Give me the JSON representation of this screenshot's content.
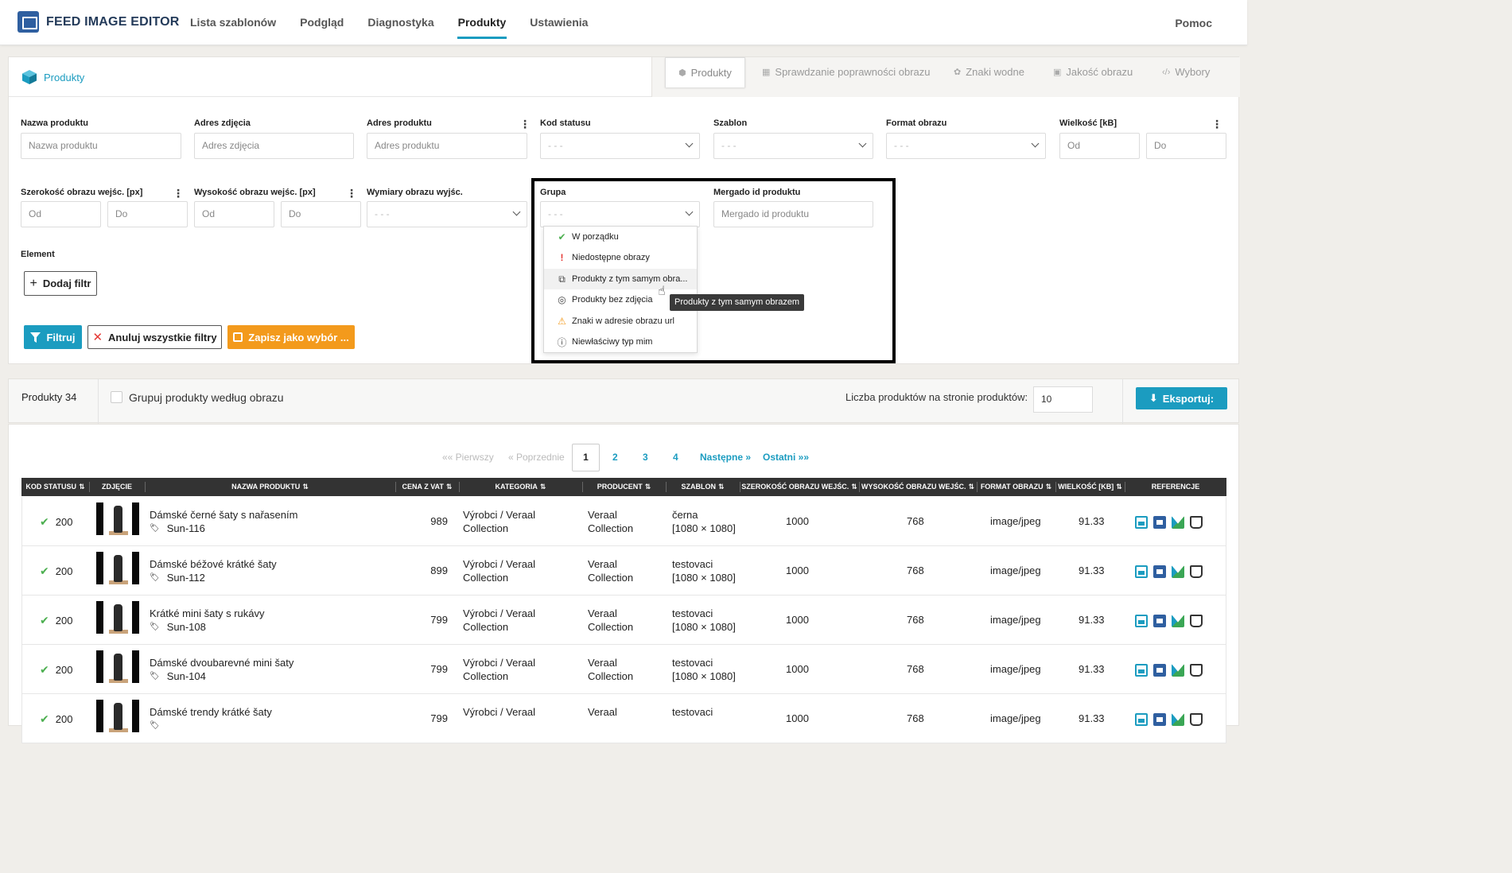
{
  "app": {
    "title": "FEED IMAGE EDITOR",
    "help": "Pomoc"
  },
  "nav": [
    "Lista szablonów",
    "Podgląd",
    "Diagnostyka",
    "Produkty",
    "Ustawienia"
  ],
  "panel": {
    "title": "Produkty",
    "tabs": [
      "Produkty",
      "Sprawdzanie poprawności obrazu",
      "Znaki wodne",
      "Jakość obrazu",
      "Wybory"
    ]
  },
  "filters": {
    "product_name": {
      "label": "Nazwa produktu",
      "placeholder": "Nazwa produktu"
    },
    "image_url": {
      "label": "Adres zdjęcia",
      "placeholder": "Adres zdjęcia"
    },
    "product_url": {
      "label": "Adres produktu",
      "placeholder": "Adres produktu"
    },
    "status_code": {
      "label": "Kod statusu",
      "value": "- - -"
    },
    "template": {
      "label": "Szablon",
      "value": "- - -"
    },
    "image_format": {
      "label": "Format obrazu",
      "value": "- - -"
    },
    "size_kb": {
      "label": "Wielkość [kB]",
      "from": "Od",
      "to": "Do"
    },
    "in_width": {
      "label": "Szerokość obrazu wejśc. [px]",
      "from": "Od",
      "to": "Do"
    },
    "in_height": {
      "label": "Wysokość obrazu wejśc. [px]",
      "from": "Od",
      "to": "Do"
    },
    "out_dims": {
      "label": "Wymiary obrazu wyjśc.",
      "value": "- - -"
    },
    "group": {
      "label": "Grupa",
      "value": "- - -"
    },
    "mergado_id": {
      "label": "Mergado id produktu",
      "placeholder": "Mergado id produktu"
    },
    "element": {
      "label": "Element"
    }
  },
  "group_options": [
    {
      "label": "W porządku",
      "icon": "check-icon"
    },
    {
      "label": "Niedostępne obrazy",
      "icon": "exclamation-icon"
    },
    {
      "label": "Produkty z tym samym obra...",
      "icon": "copy-icon"
    },
    {
      "label": "Produkty bez zdjęcia",
      "icon": "eye-slash-icon"
    },
    {
      "label": "Znaki w adresie obrazu url",
      "icon": "warning-icon"
    },
    {
      "label": "Niewłaściwy typ mim",
      "icon": "info-circle-icon"
    }
  ],
  "tooltip": "Produkty z tym samym obrazem",
  "buttons": {
    "add_filter": "Dodaj filtr",
    "filter": "Filtruj",
    "cancel_all": "Anuluj wszystkie filtry",
    "save_as": "Zapisz jako wybór ..."
  },
  "products_bar": {
    "count": "Produkty 34",
    "group_label": "Grupuj produkty według obrazu",
    "per_page_label": "Liczba produktów na stronie produktów:",
    "per_page": "10",
    "export": "Eksportuj:"
  },
  "pagination": {
    "first": "«« Pierwszy",
    "prev": "« Poprzednie",
    "pages": [
      "1",
      "2",
      "3",
      "4"
    ],
    "current": "1",
    "next": "Następne »",
    "last": "Ostatni »»"
  },
  "table": {
    "columns": [
      "KOD STATUSU",
      "ZDJĘCIE",
      "NAZWA PRODUKTU",
      "CENA Z VAT",
      "KATEGORIA",
      "PRODUCENT",
      "SZABLON",
      "SZEROKOŚĆ OBRAZU WEJŚC.",
      "WYSOKOŚĆ OBRAZU WEJŚC.",
      "FORMAT OBRAZU",
      "WIELKOŚĆ [KB]",
      "REFERENCJE"
    ],
    "rows": [
      {
        "status": "200",
        "name": "Dámské černé šaty s nařasením",
        "sku": "Sun-116",
        "price": "989",
        "cat1": "Výrobci / Veraal",
        "cat2": "Collection",
        "prod1": "Veraal",
        "prod2": "Collection",
        "tpl1": "černa",
        "tpl2": "[1080 × 1080]",
        "width": "1000",
        "height": "768",
        "format": "image/jpeg",
        "size": "91.33"
      },
      {
        "status": "200",
        "name": "Dámské béžové krátké šaty",
        "sku": "Sun-112",
        "price": "899",
        "cat1": "Výrobci / Veraal",
        "cat2": "Collection",
        "prod1": "Veraal",
        "prod2": "Collection",
        "tpl1": "testovaci",
        "tpl2": "[1080 × 1080]",
        "width": "1000",
        "height": "768",
        "format": "image/jpeg",
        "size": "91.33"
      },
      {
        "status": "200",
        "name": "Krátké mini šaty s rukávy",
        "sku": "Sun-108",
        "price": "799",
        "cat1": "Výrobci / Veraal",
        "cat2": "Collection",
        "prod1": "Veraal",
        "prod2": "Collection",
        "tpl1": "testovaci",
        "tpl2": "[1080 × 1080]",
        "width": "1000",
        "height": "768",
        "format": "image/jpeg",
        "size": "91.33"
      },
      {
        "status": "200",
        "name": "Dámské dvoubarevné mini šaty",
        "sku": "Sun-104",
        "price": "799",
        "cat1": "Výrobci / Veraal",
        "cat2": "Collection",
        "prod1": "Veraal",
        "prod2": "Collection",
        "tpl1": "testovaci",
        "tpl2": "[1080 × 1080]",
        "width": "1000",
        "height": "768",
        "format": "image/jpeg",
        "size": "91.33"
      },
      {
        "status": "200",
        "name": "Dámské trendy krátké šaty",
        "sku": "",
        "price": "799",
        "cat1": "Výrobci / Veraal",
        "cat2": "",
        "prod1": "Veraal",
        "prod2": "",
        "tpl1": "testovaci",
        "tpl2": "",
        "width": "1000",
        "height": "768",
        "format": "image/jpeg",
        "size": "91.33"
      }
    ]
  },
  "colors": {
    "accent": "#1b9cc0",
    "save": "#f39a1c",
    "ok": "#4caf50",
    "header": "#333333"
  }
}
